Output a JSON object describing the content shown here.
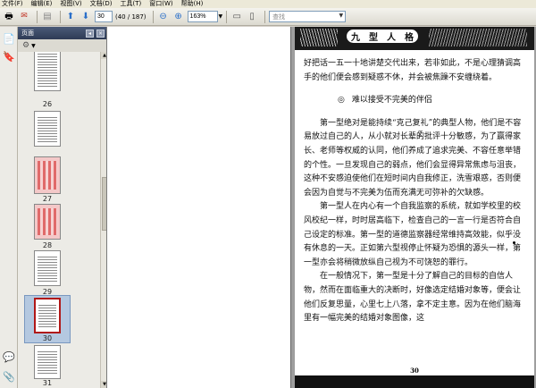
{
  "menubar": {
    "items": [
      "文件(F)",
      "编辑(E)",
      "视图(V)",
      "文档(D)",
      "工具(T)",
      "窗口(W)",
      "帮助(H)"
    ]
  },
  "toolbar": {
    "page_input": "30",
    "page_total": "(40 / 187)",
    "zoom": "163%",
    "find_placeholder": "查找"
  },
  "panel": {
    "title": "页面"
  },
  "thumbnails": [
    {
      "label": "26"
    },
    {
      "label": "27"
    },
    {
      "label": "28"
    },
    {
      "label": "29"
    },
    {
      "label": "30"
    },
    {
      "label": "31"
    }
  ],
  "page": {
    "banner_chars": [
      "九",
      "型",
      "人",
      "格"
    ],
    "para1": "好把话一五一十地讲楚交代出来，若非如此，不是心理猜调高手的他们便会感到疑惑不休，并会被焦躁不安缠绕着。",
    "section_mark": "◎",
    "section_title": "难以接受不完美的伴侣",
    "para2": "第一型绝对是能持续“克己复礼”的典型人物，他们是不容易放过自己的人，从小就对长辈的批评十分敏感，为了赢得家长、老师等权威的认同，他们养成了追求完美、不容任意举错的个性。一旦发现自己的弱点，他们会显得异常焦虑与沮丧，这种不安感迫使他们在短时间内自我修正，洗雪艰惑，否则便会因为自觉与不完美为伍而充满无可弥补的欠缺感。",
    "para3": "第一型人在内心有一个自我监察的系统，就如学校里的校风校纪一样，时时居高临下，检查自己的一言一行是否符合自己设定的标准。第一型的道德监察器经常维持高效能，似乎没有休息的一天。正如第六型视停止怀疑为恐惧的源头一样，第一型亦会将稍微放纵自己视为不可饶恕的罪行。",
    "para4": "在一般情况下，第一型是十分了解自己的目标的自信人物，然而在面临重大的决断时，好像选定结婚对象等，便会让他们反复思量，心里七上八落，拿不定主意。因为在他们脑海里有一幅完美的结婚对象图像，这",
    "page_number": "30"
  }
}
